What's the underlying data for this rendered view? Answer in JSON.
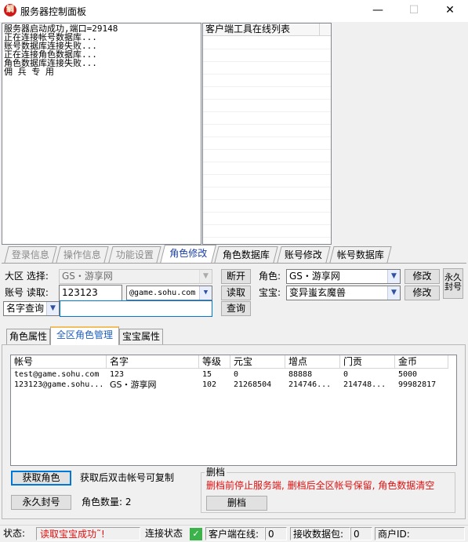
{
  "window": {
    "app_icon_text": "鲷",
    "title": "服务器控制面板",
    "minimize": "—",
    "maximize": "☐",
    "close": "✕"
  },
  "log": {
    "lines": "服务器启动成功,端口=29148\n正在连接帐号数据库...\n账号数据库连接失败...\n正在连接角色数据库...\n角色数据库连接失败...\n佣 兵 专 用"
  },
  "client_list": {
    "header": "客户端工具在线列表"
  },
  "tabs": [
    {
      "label": "登录信息"
    },
    {
      "label": "操作信息"
    },
    {
      "label": "功能设置"
    },
    {
      "label": "角色修改"
    },
    {
      "label": "角色数据库"
    },
    {
      "label": "账号修改"
    },
    {
      "label": "帐号数据库"
    }
  ],
  "form": {
    "region_label": "大区 选择:",
    "region_value": "GS・游享网",
    "disconnect_btn": "断开",
    "role_label": "角色:",
    "role_value": "GS・游享网",
    "modify_btn": "修改",
    "ban_forever_btn": "永久封号",
    "account_label": "账号 读取:",
    "account_value": "123123",
    "domain_value": "@game.sohu.com",
    "read_btn": "读取",
    "pet_label": "宝宝:",
    "pet_value": "变异蚩玄魔兽",
    "pet_modify_btn": "修改",
    "query_type": "名字查询",
    "query_value": "",
    "query_btn": "查询"
  },
  "subtabs": [
    {
      "label": "角色属性"
    },
    {
      "label": "全区角色管理"
    },
    {
      "label": "宝宝属性"
    }
  ],
  "list": {
    "columns": [
      "帐号",
      "名字",
      "等级",
      "元宝",
      "增点",
      "门贡",
      "金币"
    ],
    "rows": [
      [
        "test@game.sohu.com",
        "123",
        "15",
        "0",
        "88888",
        "0",
        "5000"
      ],
      [
        "123123@game.sohu...",
        "GS・游享网",
        "102",
        "21268504",
        "214746...",
        "214748...",
        "99982817"
      ]
    ]
  },
  "actions": {
    "get_roles_btn": "获取角色",
    "copy_hint": "获取后双击帐号可复制",
    "ban_btn": "永久封号",
    "role_count_label": "角色数量: 2",
    "delete_group_title": "删档",
    "delete_warning": "删档前停止服务端, 删档后全区帐号保留, 角色数据清空",
    "delete_btn": "删档"
  },
  "statusbar": {
    "status_label": "状态:",
    "status_text": "读取宝宝成功˜!",
    "conn_label": "连接状态",
    "conn_ok": "✓",
    "clients_label": "客户端在线:",
    "clients_value": "0",
    "packets_label": "接收数据包:",
    "packets_value": "0",
    "merchant_label": "商户ID:",
    "merchant_value": ""
  },
  "colors": {
    "accent": "#0078d7",
    "warning": "#e01010",
    "status_text": "#e01010",
    "ok_green": "#3bb34a"
  }
}
